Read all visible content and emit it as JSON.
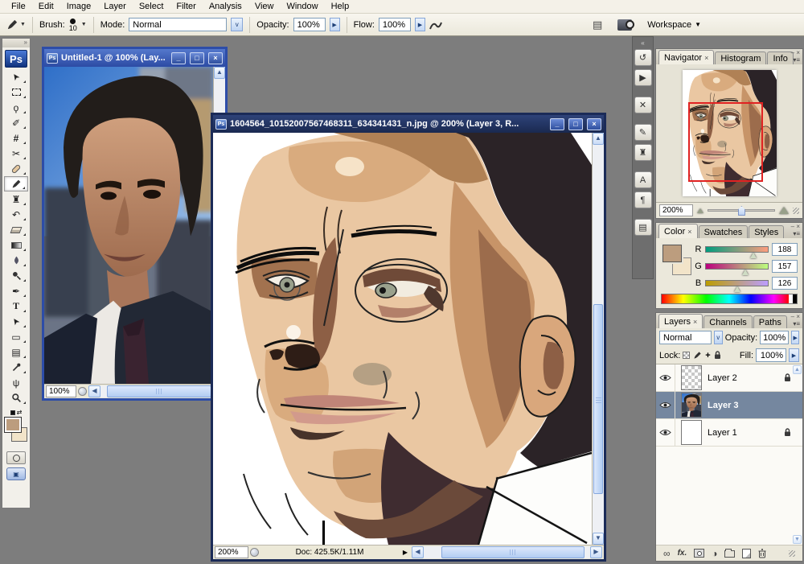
{
  "colors": {
    "workspace_bg": "#7d7d7d",
    "foreground_swatch": "#BC9D7E",
    "background_swatch": "#F2E4C9",
    "selected_layer_row": "#75879F",
    "navigator_view_rect": "#E02222",
    "active_title_bar": "#1A2950",
    "inactive_title_bar": "#2C4BA4"
  },
  "menu": {
    "items": [
      "File",
      "Edit",
      "Image",
      "Layer",
      "Select",
      "Filter",
      "Analysis",
      "View",
      "Window",
      "Help"
    ]
  },
  "options_bar": {
    "brush_label": "Brush:",
    "brush_size": "10",
    "mode_label": "Mode:",
    "mode_value": "Normal",
    "opacity_label": "Opacity:",
    "opacity_value": "100%",
    "flow_label": "Flow:",
    "flow_value": "100%",
    "workspace_label": "Workspace"
  },
  "toolbar": {
    "logo": "Ps",
    "tools": [
      {
        "name": "move",
        "glyph": "➤"
      },
      {
        "name": "rectangular-marquee",
        "glyph": ""
      },
      {
        "name": "lasso",
        "glyph": "ϙ"
      },
      {
        "name": "quick-selection",
        "glyph": "✐"
      },
      {
        "name": "crop",
        "glyph": "#"
      },
      {
        "name": "slice",
        "glyph": "✂"
      },
      {
        "name": "spot-healing-brush",
        "glyph": ""
      },
      {
        "name": "brush",
        "glyph": ""
      },
      {
        "name": "clone-stamp",
        "glyph": "♜"
      },
      {
        "name": "history-brush",
        "glyph": "↶"
      },
      {
        "name": "eraser",
        "glyph": ""
      },
      {
        "name": "gradient",
        "glyph": ""
      },
      {
        "name": "blur",
        "glyph": ""
      },
      {
        "name": "dodge",
        "glyph": ""
      },
      {
        "name": "pen",
        "glyph": "✒"
      },
      {
        "name": "type",
        "glyph": "T"
      },
      {
        "name": "path-selection",
        "glyph": "➤"
      },
      {
        "name": "rectangle-shape",
        "glyph": "▭"
      },
      {
        "name": "notes",
        "glyph": "▤"
      },
      {
        "name": "eyedropper",
        "glyph": ""
      },
      {
        "name": "hand",
        "glyph": "ψ"
      },
      {
        "name": "zoom",
        "glyph": ""
      }
    ]
  },
  "windows": {
    "win1": {
      "title": "Untitled-1 @ 100% (Lay...",
      "zoom": "100%"
    },
    "win2": {
      "title": "1604564_10152007567468311_634341431_n.jpg @ 200% (Layer 3, R...",
      "zoom": "200%",
      "doc_info": "Doc: 425.5K/1.11M"
    }
  },
  "panels": {
    "navigator": {
      "tabs": [
        "Navigator",
        "Histogram",
        "Info"
      ],
      "zoom": "200%"
    },
    "color": {
      "tabs": [
        "Color",
        "Swatches",
        "Styles"
      ],
      "channels": [
        {
          "label": "R",
          "value": "188"
        },
        {
          "label": "G",
          "value": "157"
        },
        {
          "label": "B",
          "value": "126"
        }
      ]
    },
    "layers": {
      "tabs": [
        "Layers",
        "Channels",
        "Paths"
      ],
      "blend_mode": "Normal",
      "opacity_label": "Opacity:",
      "opacity_value": "100%",
      "lock_label": "Lock:",
      "fill_label": "Fill:",
      "fill_value": "100%",
      "fx_label": "fx.",
      "items": [
        {
          "name": "Layer 2"
        },
        {
          "name": "Layer 3"
        },
        {
          "name": "Layer 1"
        }
      ]
    }
  },
  "icons": {
    "doc_badge": "Ps",
    "window_min": "_",
    "window_max": "□",
    "window_close": "×",
    "toolbar_grip": "»",
    "dock_grip": "«",
    "panel_menu": "▾≡",
    "corner_min": "‒",
    "corner_close": "×",
    "tab_close": "×",
    "combo_arrow": "▼",
    "combo_arrow_sm": "v",
    "spinner_arrow": "▶",
    "status_menu_arrow": "▶",
    "scroll_up": "▲",
    "scroll_down": "▼",
    "scroll_left": "◀",
    "scroll_right": "▶",
    "swap_arrow": "⇄",
    "lock_move": "+",
    "palettes": "▤",
    "chain": "∞",
    "adjustment": "◑",
    "dock_buttons": [
      {
        "name": "history",
        "glyph": "↺"
      },
      {
        "name": "actions",
        "glyph": "▶"
      },
      {
        "name": "tool-presets",
        "glyph": "✕"
      },
      {
        "name": "brushes",
        "glyph": "✎"
      },
      {
        "name": "clone-source",
        "glyph": "♜"
      },
      {
        "name": "character",
        "glyph": "A"
      },
      {
        "name": "paragraph",
        "glyph": "¶"
      },
      {
        "name": "layer-comps",
        "glyph": "▤"
      }
    ]
  }
}
